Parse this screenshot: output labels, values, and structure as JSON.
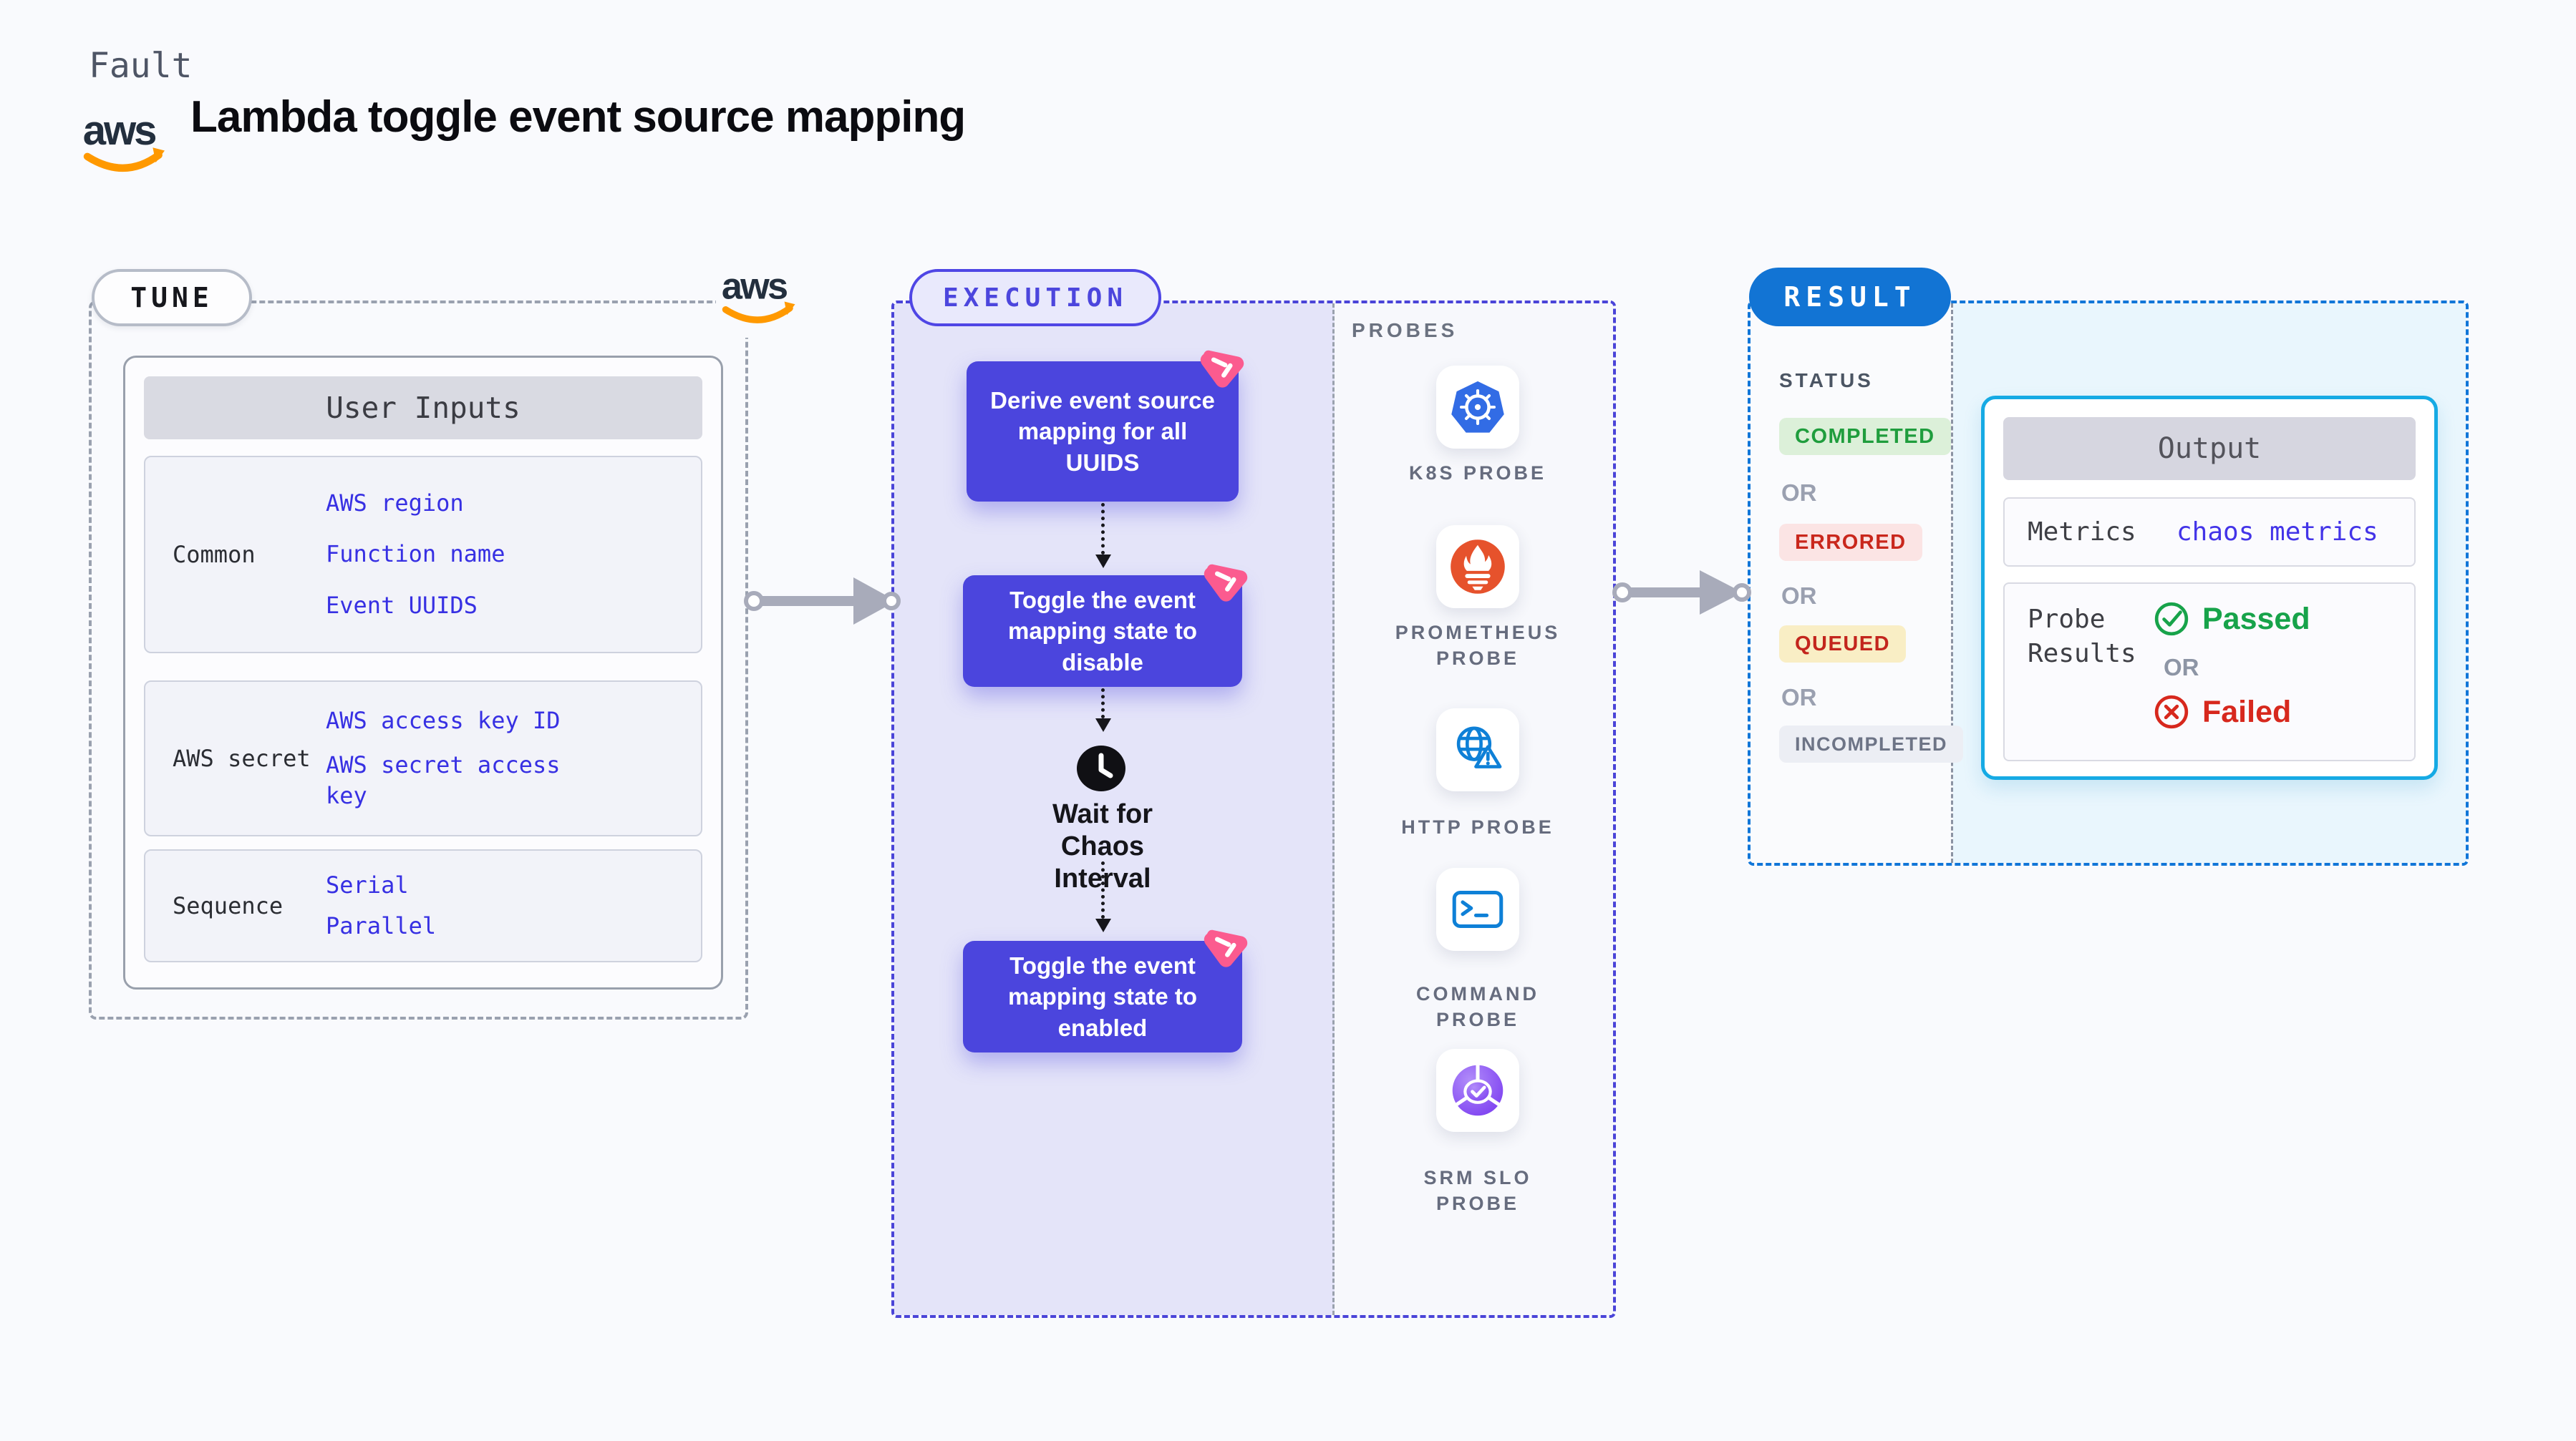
{
  "header": {
    "eyebrow": "Fault",
    "title": "Lambda toggle event source mapping",
    "aws_label": "aws"
  },
  "tune": {
    "badge": "TUNE",
    "table": {
      "title": "User Inputs",
      "rows": [
        {
          "label": "Common",
          "links": [
            "AWS region",
            "Function name",
            "Event UUIDS"
          ]
        },
        {
          "label": "AWS secret",
          "links": [
            "AWS access key ID",
            "AWS secret access key"
          ]
        },
        {
          "label": "Sequence",
          "links": [
            "Serial",
            "Parallel"
          ]
        }
      ]
    }
  },
  "execution": {
    "badge": "EXECUTION",
    "steps": [
      "Derive event source mapping for all UUIDS",
      "Toggle the event mapping state to disable",
      "Toggle the event mapping state to enabled"
    ],
    "wait_label": "Wait for Chaos Interval"
  },
  "probes": {
    "title": "PROBES",
    "items": [
      {
        "label": "K8S PROBE",
        "icon": "kubernetes-icon"
      },
      {
        "label": "PROMETHEUS PROBE",
        "icon": "prometheus-icon"
      },
      {
        "label": "HTTP PROBE",
        "icon": "globe-warning-icon"
      },
      {
        "label": "COMMAND PROBE",
        "icon": "terminal-icon"
      },
      {
        "label": "SRM SLO PROBE",
        "icon": "slo-gauge-icon"
      }
    ]
  },
  "result": {
    "badge": "RESULT",
    "status": {
      "title": "STATUS",
      "or": "OR",
      "badges": [
        {
          "label": "COMPLETED",
          "color": "#1f9d3d",
          "bg": "#dcf0d9"
        },
        {
          "label": "ERRORED",
          "color": "#c9271c",
          "bg": "#fbe4e4"
        },
        {
          "label": "QUEUED",
          "color": "#c3251d",
          "bg": "#f9eec5"
        },
        {
          "label": "INCOMPLETED",
          "color": "#6d7486",
          "bg": "#eceef4"
        }
      ]
    },
    "output": {
      "title": "Output",
      "metrics_label": "Metrics",
      "metrics_value": "chaos metrics",
      "probe_results_label": "Probe Results",
      "passed": "Passed",
      "or": "OR",
      "failed": "Failed"
    }
  },
  "colors": {
    "page_bg": "#f9fafd",
    "indigo_accent": "#4f46e5",
    "node_purple": "#4b45dd",
    "execution_bg": "#e4e4f9",
    "link_blue": "#3730e3",
    "result_blue": "#1274d4",
    "output_border_cyan": "#16aae4",
    "result_bg": "#e9f6fd",
    "chaos_pink": "#fb5b8f",
    "aws_orange": "#ff9900",
    "green": "#17a34a",
    "red": "#d7281d"
  }
}
